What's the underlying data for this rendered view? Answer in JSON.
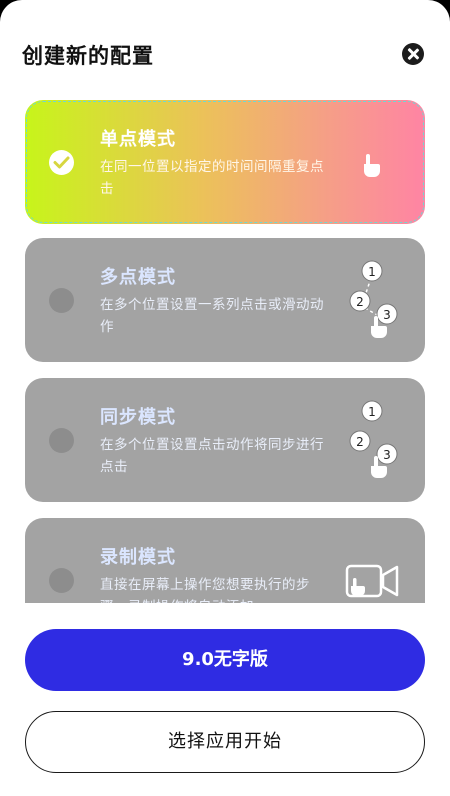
{
  "dialog": {
    "title": "创建新的配置"
  },
  "modes": [
    {
      "title": "单点模式",
      "desc": "在同一位置以指定的时间间隔重复点击",
      "selected": true,
      "icon": "single-tap-icon"
    },
    {
      "title": "多点模式",
      "desc": "在多个位置设置一系列点击或滑动动作",
      "selected": false,
      "icon": "multi-tap-icon",
      "steps": [
        "1",
        "2",
        "3"
      ]
    },
    {
      "title": "同步模式",
      "desc": "在多个位置设置点击动作将同步进行点击",
      "selected": false,
      "icon": "sync-tap-icon",
      "steps": [
        "1",
        "2",
        "3"
      ]
    },
    {
      "title": "录制模式",
      "desc": "直接在屏幕上操作您想要执行的步骤，录制操作将自动添加",
      "selected": false,
      "icon": "record-video-icon"
    }
  ],
  "buttons": {
    "primary_label": "9.0无字版",
    "secondary_label": "选择应用开始"
  },
  "colors": {
    "primary": "#2f2ce3",
    "card_gray": "#a3a3a3",
    "gradient_start": "#c7f51a",
    "gradient_end": "#ff84a4"
  }
}
